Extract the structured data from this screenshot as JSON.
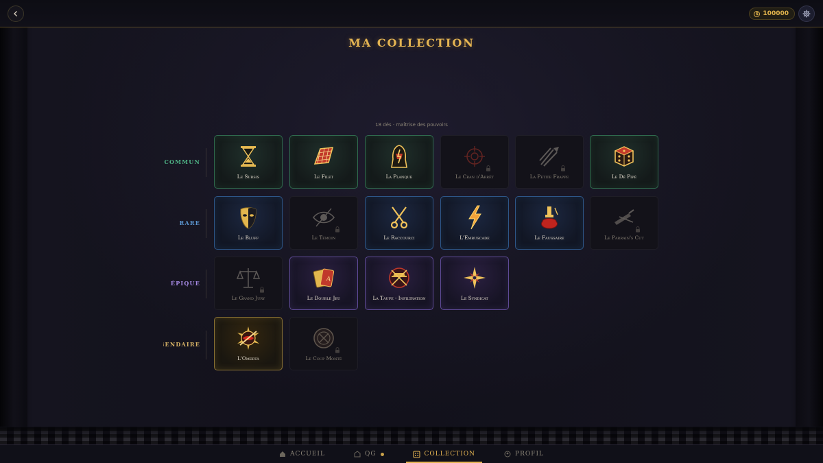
{
  "header": {
    "coins": "100000",
    "title": "MA COLLECTION"
  },
  "collection": {
    "subtitle": "18 dés · maîtrise des pouvoirs"
  },
  "rarities": {
    "commun": "COMMUN",
    "rare": "RARE",
    "epique": "ÉPIQUE",
    "legendaire": "LÉGENDAIRE"
  },
  "cards": {
    "c1": "Le Sursis",
    "c2": "Le Filet",
    "c3": "La Planque",
    "c4": "Le Cran d'Arrêt",
    "c5": "La Petite Frappe",
    "c6": "Le Dé Pipé",
    "r1": "Le Bluff",
    "r2": "Le Témoin",
    "r3": "Le Raccourci",
    "r4": "L'Embuscade",
    "r5": "Le Faussaire",
    "r6": "Le Parrain's Cut",
    "e1": "Le Grand Jury",
    "e2": "Le Double Jeu",
    "e3": "La Taupe - Infiltration",
    "e4": "Le Syndicat",
    "l1": "L'Omertà",
    "l2": "Le Coup Monté"
  },
  "nav": {
    "accueil": "ACCUEIL",
    "qg": "QG",
    "collection": "COLLECTION",
    "profil": "PROFIL"
  },
  "colors": {
    "gold": "#e4b452",
    "commun": "#4fb386",
    "rare": "#5b95cf",
    "epique": "#a78ae6",
    "legendaire": "#d6b266"
  }
}
